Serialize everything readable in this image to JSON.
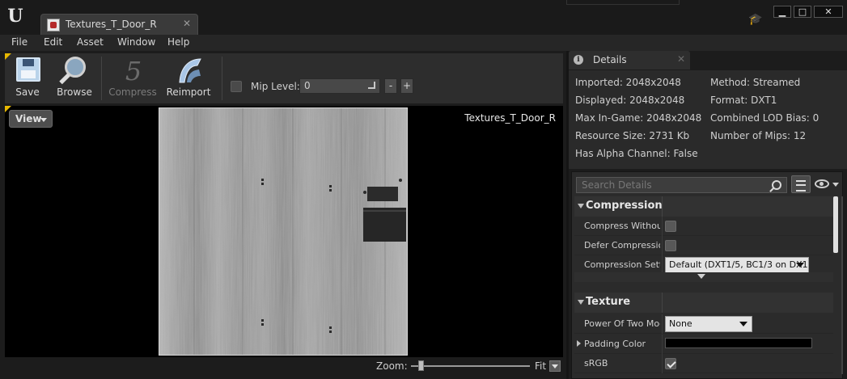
{
  "window": {
    "tab_title": "Textures_T_Door_R",
    "controls": {
      "minimize": "▁",
      "maximize": "□",
      "close": "✕"
    }
  },
  "menu": [
    "File",
    "Edit",
    "Asset",
    "Window",
    "Help"
  ],
  "toolbar": {
    "buttons": [
      {
        "label": "Save",
        "icon": "save-icon",
        "enabled": true
      },
      {
        "label": "Browse",
        "icon": "browse-icon",
        "enabled": true
      },
      {
        "label": "Compress",
        "icon": "compress-icon",
        "enabled": false
      },
      {
        "label": "Reimport",
        "icon": "reimport-icon",
        "enabled": true
      }
    ],
    "mip_level_label": "Mip Level:",
    "mip_level_value": "0",
    "minus": "-",
    "plus": "+"
  },
  "viewport": {
    "view_button": "View",
    "texture_name": "Textures_T_Door_R"
  },
  "zoom": {
    "label": "Zoom:",
    "mode": "Fit"
  },
  "details": {
    "tab_label": "Details",
    "info": {
      "imported": "Imported: 2048x2048",
      "displayed": "Displayed: 2048x2048",
      "max_in_game": "Max In-Game: 2048x2048",
      "resource_size": "Resource Size: 2731 Kb",
      "has_alpha": "Has Alpha Channel: False",
      "method": "Method: Streamed",
      "format": "Format: DXT1",
      "lod_bias": "Combined LOD Bias: 0",
      "num_mips": "Number of Mips: 12"
    },
    "search_placeholder": "Search Details",
    "categories": {
      "compression": "Compression",
      "texture": "Texture"
    },
    "compression_props": {
      "compress_without": "Compress Without",
      "defer_compression": "Defer Compressior",
      "compression_settings": "Compression Setti",
      "compression_settings_value": "Default (DXT1/5, BC1/3 on DX1"
    },
    "texture_props": {
      "power_of_two": "Power Of Two Moc",
      "power_of_two_value": "None",
      "padding_color": "Padding Color",
      "srgb": "sRGB"
    }
  },
  "colors": {
    "accent_corner": "#e8b800",
    "panel_bg": "#2b2b2b",
    "window_bg": "#151515"
  }
}
